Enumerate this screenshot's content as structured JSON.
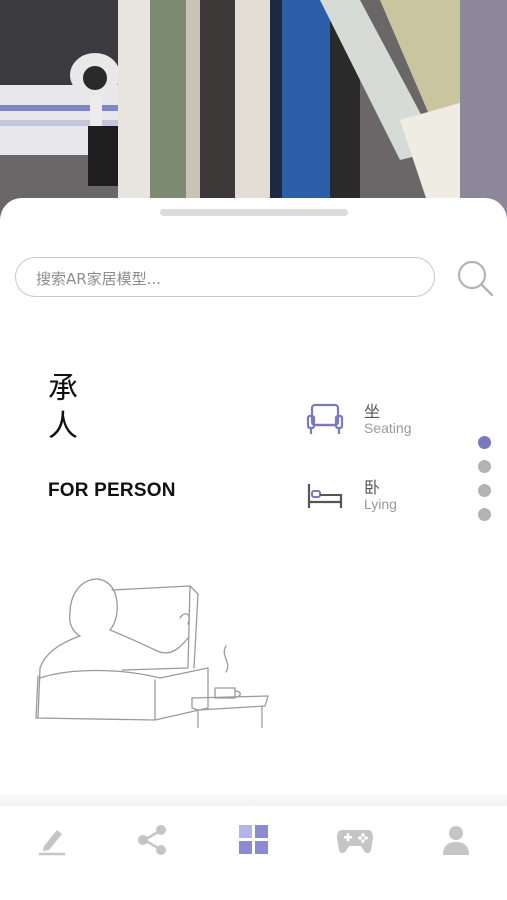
{
  "search": {
    "placeholder": "搜索AR家居模型..."
  },
  "category": {
    "title_zh": "承人",
    "title_en": "FOR PERSON"
  },
  "subcategories": [
    {
      "label_zh": "坐",
      "label_en": "Seating",
      "icon": "armchair-icon"
    },
    {
      "label_zh": "卧",
      "label_en": "Lying",
      "icon": "bed-icon"
    }
  ],
  "pager": {
    "count": 4,
    "active_index": 0
  },
  "tabs": [
    {
      "name": "edit",
      "icon": "pencil-icon",
      "active": false
    },
    {
      "name": "share",
      "icon": "share-icon",
      "active": false
    },
    {
      "name": "catalog",
      "icon": "grid-icon",
      "active": true
    },
    {
      "name": "game",
      "icon": "gamepad-icon",
      "active": false
    },
    {
      "name": "profile",
      "icon": "user-icon",
      "active": false
    }
  ],
  "colors": {
    "accent": "#7b78c2",
    "accent_light": "#b6b4e6",
    "inactive": "#c5c5c5",
    "text": "#111111"
  }
}
